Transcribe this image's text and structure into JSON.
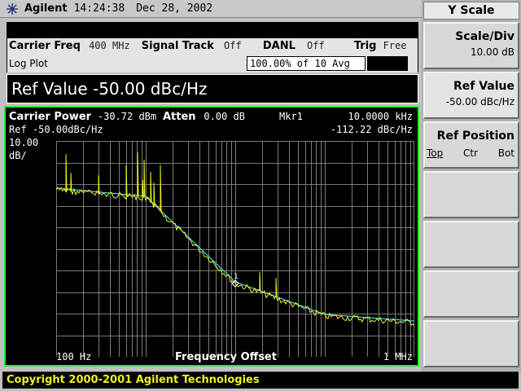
{
  "title_bar": {
    "brand": "Agilent",
    "time": "14:24:38",
    "date": "Dec 28, 2002"
  },
  "info": {
    "carrier_freq_label": "Carrier Freq",
    "carrier_freq_value": "400 MHz",
    "signal_track_label": "Signal Track",
    "signal_track_value": "Off",
    "danl_label": "DANL",
    "danl_value": "Off",
    "trig_label": "Trig",
    "trig_value": "Free",
    "log_plot": "Log Plot",
    "avg_status": "100.00% of 10 Avg"
  },
  "ref_entry": "Ref Value -50.00 dBc/Hz",
  "graph": {
    "carrier_power_label": "Carrier Power",
    "carrier_power_value": "-30.72 dBm",
    "atten_label": "Atten",
    "atten_value": "0.00 dB",
    "marker_label": "Mkr1",
    "marker_freq": "10.0000 kHz",
    "marker_value": "-112.22 dBc/Hz",
    "ref_line": "Ref -50.00dBc/Hz",
    "scale_value": "10.00",
    "scale_unit": "dB/",
    "x_start": "100 Hz",
    "x_label": "Frequency Offset",
    "x_stop": "1 MHz",
    "marker_number": "1"
  },
  "footer": "Copyright 2000-2001 Agilent Technologies",
  "menu": {
    "title": "Y Scale",
    "scale_div_label": "Scale/Div",
    "scale_div_value": "10.00 dB",
    "ref_value_label": "Ref Value",
    "ref_value_value": "-50.00 dBc/Hz",
    "ref_position_label": "Ref Position",
    "ref_position_opts": [
      "Top",
      "Ctr",
      "Bot"
    ]
  },
  "colors": {
    "trace_yellow": "#f0f020",
    "trace_cyan": "#40d8e8",
    "frame_green": "#2ee82e"
  }
}
